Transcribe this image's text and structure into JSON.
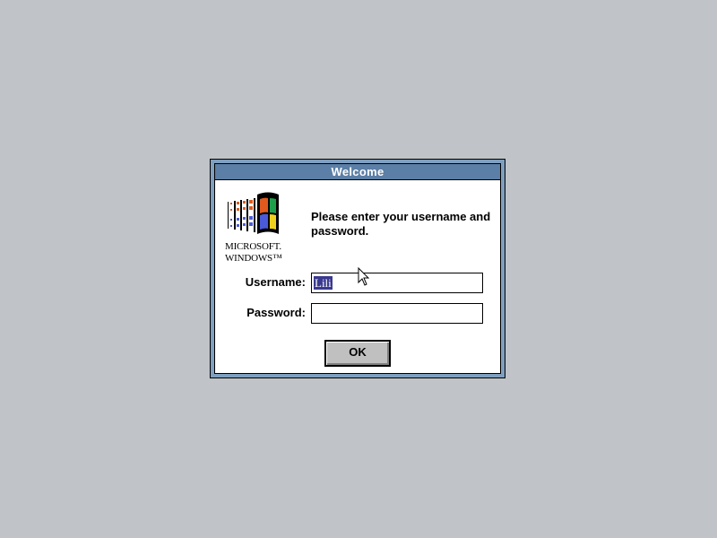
{
  "dialog": {
    "title": "Welcome",
    "prompt": "Please enter your username and password.",
    "logo": {
      "icon": "windows-flag-logo",
      "line1": "MICROSOFT.",
      "line2": "WINDOWS™"
    },
    "username": {
      "label": "Username:",
      "value": "Lili"
    },
    "password": {
      "label": "Password:",
      "value": ""
    },
    "ok_label": "OK"
  },
  "colors": {
    "desktop": "#c0c4c8",
    "titlebar": "#5b7fa6",
    "frame": "#7f9fbf",
    "selection": "#39398f",
    "button": "#c0c0c0"
  }
}
